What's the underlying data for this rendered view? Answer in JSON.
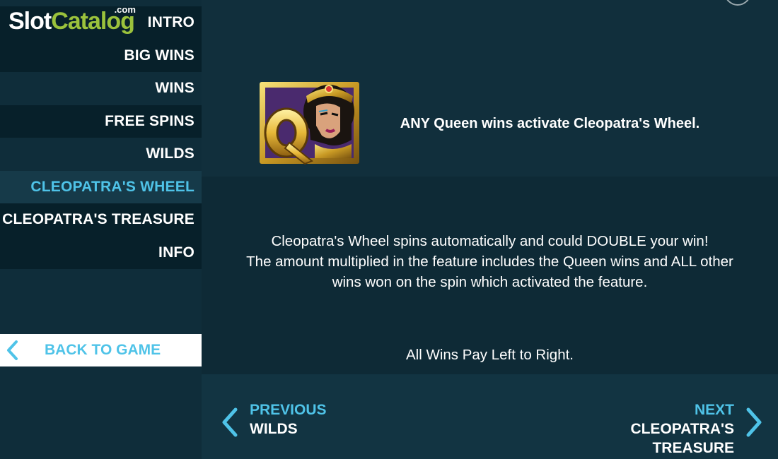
{
  "logo": {
    "part1": "Slot",
    "part2": "Catalog",
    "suffix": ".com"
  },
  "sidebar": {
    "items": [
      {
        "label": "INTRO"
      },
      {
        "label": "BIG WINS"
      },
      {
        "label": "WINS"
      },
      {
        "label": "FREE SPINS"
      },
      {
        "label": "WILDS"
      },
      {
        "label": "CLEOPATRA'S WHEEL",
        "active": true
      },
      {
        "label": "CLEOPATRA'S TREASURE"
      },
      {
        "label": "INFO"
      }
    ],
    "back_label": "BACK TO GAME"
  },
  "content": {
    "headline": "ANY Queen wins activate Cleopatra's Wheel.",
    "description_lines": [
      "Cleopatra's Wheel spins automatically and could DOUBLE your win!",
      "The amount multiplied in the feature includes the Queen wins and ALL other",
      "wins won on the spin which activated the feature."
    ],
    "pay_direction": "All Wins Pay Left to Right.",
    "symbol_icon": "queen-symbol-icon"
  },
  "navigation": {
    "previous": {
      "kicker": "PREVIOUS",
      "target": "WILDS"
    },
    "next": {
      "kicker": "NEXT",
      "target_line1": "CLEOPATRA'S",
      "target_line2": "TREASURE"
    }
  },
  "colors": {
    "background": "#0f2d3a",
    "accent": "#4fc3e8",
    "logo_green": "#9bc23c",
    "text": "#ffffff"
  }
}
